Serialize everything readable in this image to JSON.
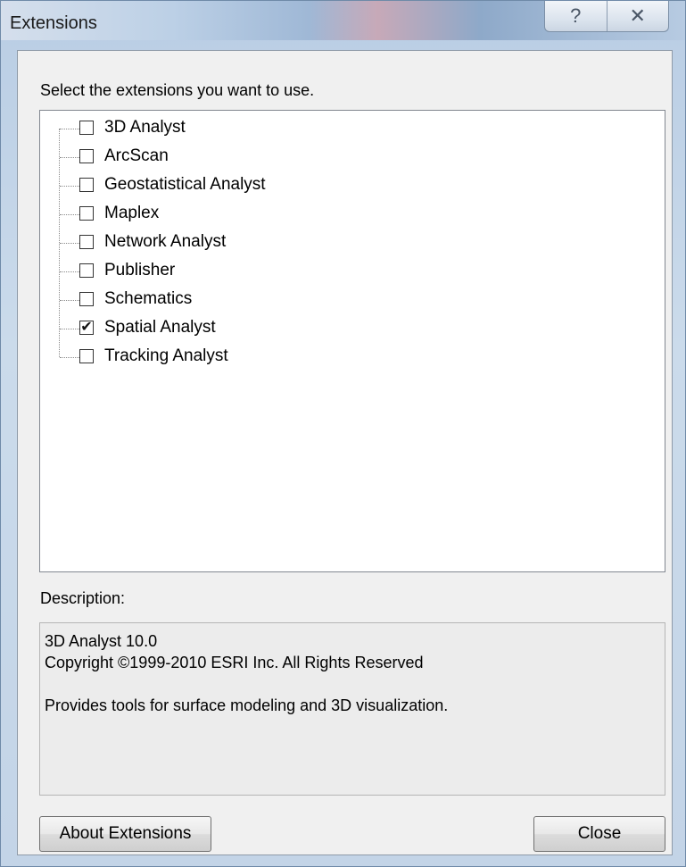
{
  "window": {
    "title": "Extensions",
    "help_glyph": "?",
    "close_glyph": "✕"
  },
  "instruction": "Select the extensions you want to use.",
  "extensions": [
    {
      "label": "3D Analyst",
      "checked": false,
      "mark": ""
    },
    {
      "label": "ArcScan",
      "checked": false,
      "mark": ""
    },
    {
      "label": "Geostatistical Analyst",
      "checked": false,
      "mark": ""
    },
    {
      "label": "Maplex",
      "checked": false,
      "mark": ""
    },
    {
      "label": "Network Analyst",
      "checked": false,
      "mark": ""
    },
    {
      "label": "Publisher",
      "checked": false,
      "mark": ""
    },
    {
      "label": "Schematics",
      "checked": false,
      "mark": ""
    },
    {
      "label": "Spatial Analyst",
      "checked": true,
      "mark": "✔"
    },
    {
      "label": "Tracking Analyst",
      "checked": false,
      "mark": ""
    }
  ],
  "description": {
    "label": "Description:",
    "line1": "3D Analyst 10.0",
    "line2": "Copyright ©1999-2010 ESRI Inc. All Rights Reserved",
    "line3": "Provides tools for surface modeling and 3D visualization."
  },
  "buttons": {
    "about": "About Extensions",
    "close": "Close"
  }
}
